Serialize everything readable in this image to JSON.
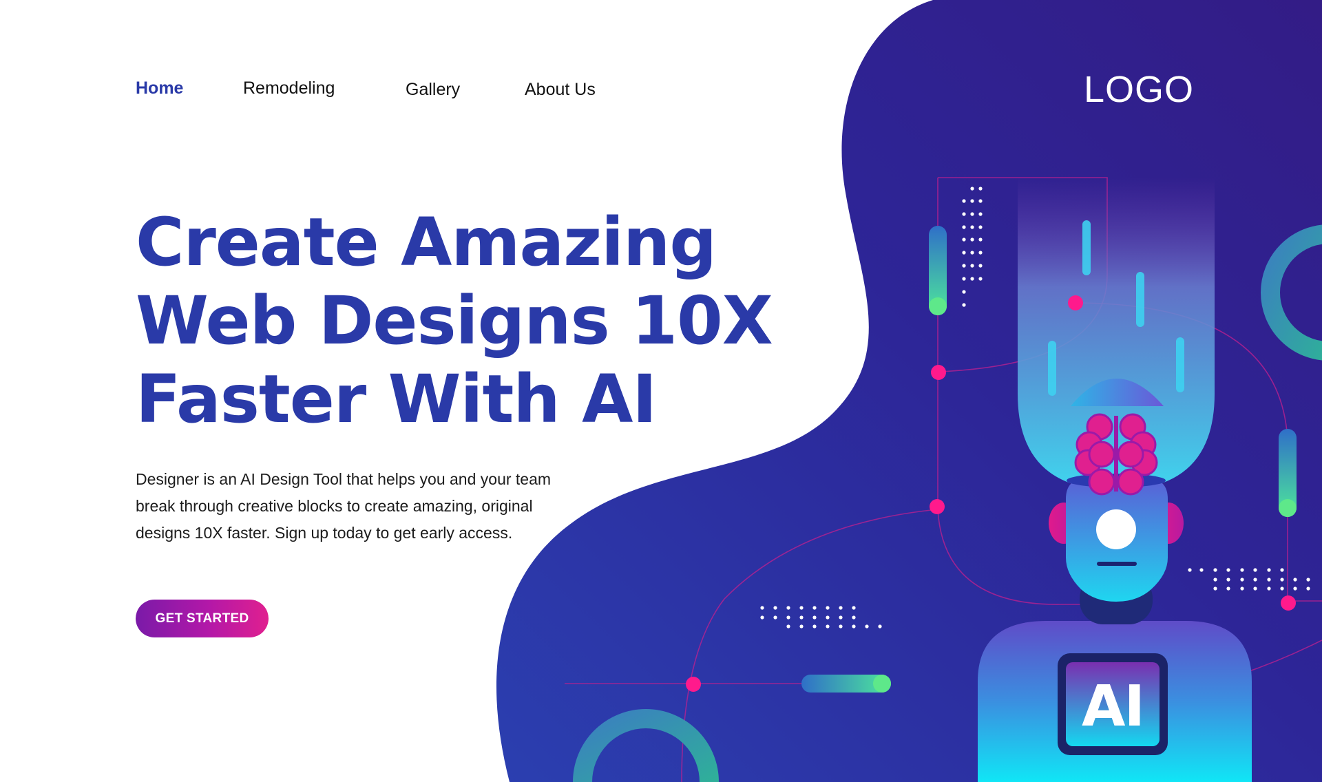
{
  "nav": {
    "items": [
      {
        "label": "Home",
        "active": true
      },
      {
        "label": "Remodeling",
        "active": false
      },
      {
        "label": "Gallery",
        "active": false
      },
      {
        "label": "About Us",
        "active": false
      }
    ]
  },
  "logo": {
    "text": "LOGO"
  },
  "hero": {
    "title_lines": [
      "Create Amazing",
      "Web Designs 10X",
      "Faster With AI"
    ],
    "description": "Designer is an AI Design Tool that helps you and your team break through creative blocks to create amazing, original designs 10X faster. Sign up today to get early access.",
    "cta_label": "GET STARTED"
  },
  "illustration": {
    "badge_text": "AI"
  },
  "colors": {
    "brand_blue": "#2a3aa8",
    "blob_dark": "#2f1f8f",
    "accent_pink": "#ff1a8c",
    "accent_green": "#5ee88a",
    "accent_cyan": "#14e0f0",
    "cta_start": "#7a1aa8",
    "cta_end": "#e0208f"
  }
}
